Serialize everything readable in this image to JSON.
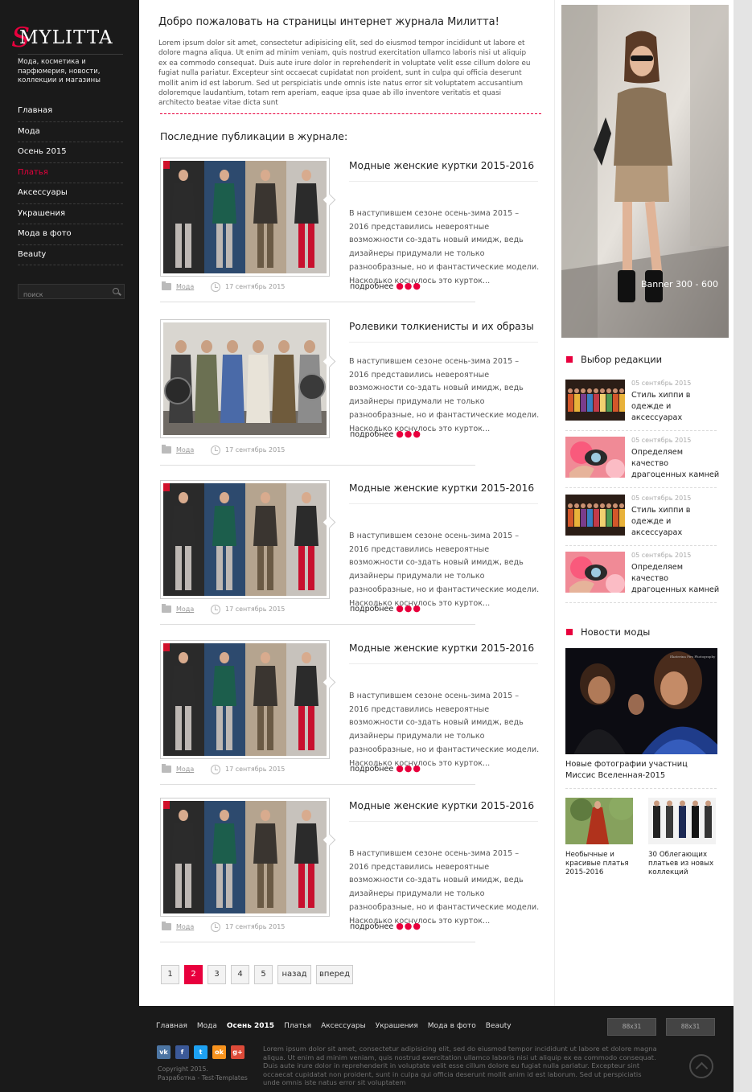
{
  "sidebar": {
    "logo_initial": "S",
    "logo_text": "MYLITTA",
    "tagline": "Мода, косметика и парфюмерия, новости, коллекции и магазины",
    "nav": [
      {
        "label": "Главная",
        "active": false
      },
      {
        "label": "Мода",
        "active": false
      },
      {
        "label": "Осень 2015",
        "active": false
      },
      {
        "label": "Платья",
        "active": true
      },
      {
        "label": "Аксессуары",
        "active": false
      },
      {
        "label": "Украшения",
        "active": false
      },
      {
        "label": "Мода в фото",
        "active": false
      },
      {
        "label": "Beauty",
        "active": false
      }
    ],
    "search_placeholder": "поиск"
  },
  "main": {
    "welcome_title": "Добро пожаловать на страницы интернет журнала Милитта!",
    "welcome_text": "Lorem ipsum dolor sit amet, consectetur adipisicing elit, sed do eiusmod tempor incididunt ut labore et dolore magna aliqua. Ut enim ad minim veniam, quis nostrud exercitation ullamco laboris nisi ut aliquip ex ea commodo consequat. Duis aute irure dolor in reprehenderit in voluptate velit esse cillum dolore eu fugiat nulla pariatur. Excepteur sint occaecat cupidatat non proident, sunt in culpa qui officia deserunt mollit anim id est laborum. Sed ut perspiciatis unde omnis iste natus error sit voluptatem accusantium doloremque laudantium, totam rem aperiam, eaque ipsa quae ab illo inventore veritatis et quasi architecto beatae vitae dicta sunt",
    "latest_title": "Последние публикации в журнале:",
    "posts": [
      {
        "title": "Модные женские куртки 2015-2016",
        "excerpt": "В наступившем сезоне осень-зима 2015 – 2016 представились невероятные возможности со-здать новый имидж, ведь дизайнеры придумали не только разнообразные, но и фантастические модели. Насколько коснулось это курток...",
        "more": "подробнее",
        "dots": "●●●",
        "category": "Мода",
        "date": "17 сентябрь 2015"
      },
      {
        "title": "Ролевики толкиенисты и их образы",
        "excerpt": "В наступившем сезоне осень-зима 2015 – 2016 представились невероятные возможности со-здать новый имидж, ведь дизайнеры придумали не только разнообразные, но и фантастические модели. Насколько коснулось это курток...",
        "more": "подробнее",
        "dots": "●●●",
        "category": "Мода",
        "date": "17 сентябрь 2015"
      },
      {
        "title": "Модные женские куртки 2015-2016",
        "excerpt": "В наступившем сезоне осень-зима 2015 – 2016 представились невероятные возможности со-здать новый имидж, ведь дизайнеры придумали не только разнообразные, но и фантастические модели. Насколько коснулось это курток...",
        "more": "подробнее",
        "dots": "●●●",
        "category": "Мода",
        "date": "17 сентябрь 2015"
      },
      {
        "title": "Модные женские куртки 2015-2016",
        "excerpt": "В наступившем сезоне осень-зима 2015 – 2016 представились невероятные возможности со-здать новый имидж, ведь дизайнеры придумали не только разнообразные, но и фантастические модели. Насколько коснулось это курток...",
        "more": "подробнее",
        "dots": "●●●",
        "category": "Мода",
        "date": "17 сентябрь 2015"
      },
      {
        "title": "Модные женские куртки 2015-2016",
        "excerpt": "В наступившем сезоне осень-зима 2015 – 2016 представились невероятные возможности со-здать новый имидж, ведь дизайнеры придумали не только разнообразные, но и фантастические модели. Насколько коснулось это курток...",
        "more": "подробнее",
        "dots": "●●●",
        "category": "Мода",
        "date": "17 сентябрь 2015"
      }
    ],
    "pagination": {
      "pages": [
        "1",
        "2",
        "3",
        "4",
        "5"
      ],
      "current": "2",
      "prev_label": "назад",
      "next_label": "вперед"
    }
  },
  "right": {
    "banner_label": "Banner 300 - 600",
    "editors_pick_title": "Выбор редакции",
    "editors_pick": [
      {
        "date": "05 сентябрь 2015",
        "title": "Стиль хиппи в одежде и аксессуарах"
      },
      {
        "date": "05 сентябрь 2015",
        "title": "Определяем качество драгоценных камней"
      },
      {
        "date": "05 сентябрь 2015",
        "title": "Стиль хиппи в одежде и аксессуарах"
      },
      {
        "date": "05 сентябрь 2015",
        "title": "Определяем качество драгоценных камней"
      }
    ],
    "fashion_news_title": "Новости моды",
    "fashion_news_main": "Новые фотографии участниц Миссис Вселенная-2015",
    "fashion_news_small": [
      {
        "title": "Необычные и красивые платья 2015-2016"
      },
      {
        "title": "30 Облегающих платьев из новых коллекций"
      }
    ]
  },
  "footer": {
    "nav": [
      {
        "label": "Главная",
        "bold": false
      },
      {
        "label": "Мода",
        "bold": false
      },
      {
        "label": "Осень 2015",
        "bold": true
      },
      {
        "label": "Платья",
        "bold": false
      },
      {
        "label": "Аксессуары",
        "bold": false
      },
      {
        "label": "Украшения",
        "bold": false
      },
      {
        "label": "Мода в фото",
        "bold": false
      },
      {
        "label": "Beauty",
        "bold": false
      }
    ],
    "badges": [
      "88x31",
      "88x31"
    ],
    "social": [
      {
        "icon": "vk-icon",
        "glyph": "vk",
        "color": "#4c75a3"
      },
      {
        "icon": "facebook-icon",
        "glyph": "f",
        "color": "#3b5998"
      },
      {
        "icon": "twitter-icon",
        "glyph": "t",
        "color": "#1da1f2"
      },
      {
        "icon": "odnoklassniki-icon",
        "glyph": "ok",
        "color": "#f7931e"
      },
      {
        "icon": "google-plus-icon",
        "glyph": "g+",
        "color": "#dd4b39"
      }
    ],
    "copyright_line1": "Copyright 2015.",
    "copyright_line2": "Разработка - Test-Templates",
    "text": "Lorem ipsum dolor sit amet, consectetur adipisicing elit, sed do eiusmod tempor incididunt ut labore et dolore magna aliqua. Ut enim ad minim veniam, quis nostrud exercitation ullamco laboris nisi ut aliquip ex ea commodo consequat. Duis aute irure dolor in reprehenderit in voluptate velit esse cillum dolore eu fugiat nulla pariatur. Excepteur sint occaecat cupidatat non proident, sunt in culpa qui officia deserunt mollit anim id est laborum. Sed ut perspiciatis unde omnis iste natus error sit voluptatem"
  },
  "colors": {
    "accent": "#e8003d",
    "dark": "#1a1a1a"
  }
}
